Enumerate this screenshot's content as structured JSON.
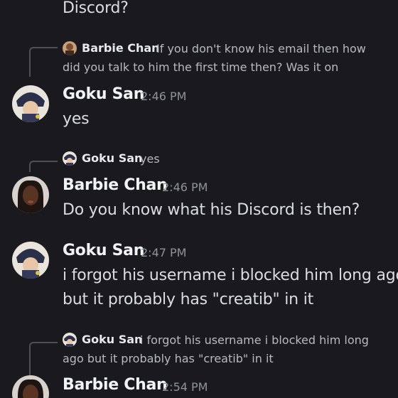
{
  "messages": [
    {
      "text_lines": [
        "Discord?"
      ]
    },
    {
      "reply": {
        "author": "Barbie Chan",
        "text_lines": [
          "If you don't know his email then how",
          "did you talk to him the first time then? Was it on"
        ]
      },
      "author": "Goku San",
      "time": "2:46 PM",
      "text_lines": [
        "yes"
      ]
    },
    {
      "reply": {
        "author": "Goku San",
        "text_lines": [
          "yes"
        ]
      },
      "author": "Barbie Chan",
      "time": "2:46 PM",
      "text_lines": [
        "Do you know what his Discord is then?"
      ]
    },
    {
      "author": "Goku San",
      "time": "2:47 PM",
      "text_lines": [
        "i forgot his username i blocked him long ago",
        "but it probably has \"creatib\" in it"
      ]
    },
    {
      "reply": {
        "author": "Goku San",
        "text_lines": [
          "i forgot his username i blocked him long",
          "ago but it probably has \"creatib\" in it"
        ]
      },
      "author": "Barbie Chan",
      "time": "2:54 PM"
    }
  ],
  "colors": {
    "background": "#1a1a1e",
    "author": "#f2f3f5",
    "text": "#dcdde0",
    "timestamp": "#8f939b",
    "reply_connector": "#4e5058"
  },
  "icons": {
    "goku_avatar": "anime-character-avatar",
    "barbie_avatar": "woman-portrait-avatar"
  }
}
